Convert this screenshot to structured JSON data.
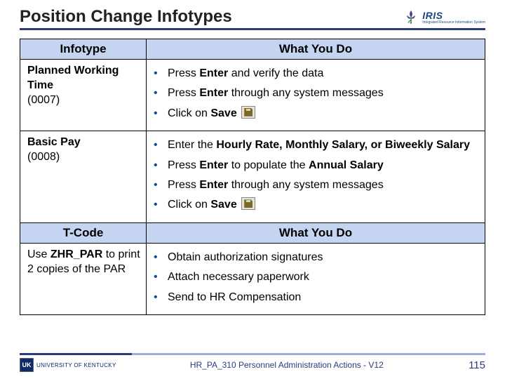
{
  "title": "Position Change Infotypes",
  "logo": {
    "text": "IRIS",
    "sub": "Integrated Resource Information System"
  },
  "table": {
    "headers1": {
      "left": "Infotype",
      "right": "What You Do"
    },
    "rows": [
      {
        "left_bold": "Planned Working Time",
        "left_plain": "(0007)",
        "items": [
          {
            "pre": "Press ",
            "b1": "Enter",
            "mid": " and verify the data"
          },
          {
            "pre": "Press ",
            "b1": "Enter",
            "mid": " through any system messages"
          },
          {
            "pre": "Click on ",
            "b1": "Save",
            "icon": true
          }
        ]
      },
      {
        "left_bold": "Basic Pay",
        "left_plain": "(0008)",
        "items": [
          {
            "pre": "Enter the ",
            "b1": "Hourly Rate, Monthly Salary, or Biweekly Salary"
          },
          {
            "pre": "Press ",
            "b1": "Enter",
            "mid": " to populate the ",
            "b2": "Annual Salary"
          },
          {
            "pre": "Press ",
            "b1": "Enter",
            "mid": " through any system messages"
          },
          {
            "pre": "Click on ",
            "b1": "Save",
            "icon": true
          }
        ]
      }
    ],
    "headers2": {
      "left": "T-Code",
      "right": "What You Do"
    },
    "rows2": [
      {
        "left_pre": "Use ",
        "left_bold": "ZHR_PAR",
        "left_post": " to print 2 copies of the PAR",
        "items": [
          {
            "pre": "Obtain authorization signatures"
          },
          {
            "pre": "Attach necessary paperwork"
          },
          {
            "pre": "Send to HR Compensation"
          }
        ]
      }
    ]
  },
  "footer": {
    "uk": "UNIVERSITY OF KENTUCKY",
    "center": "HR_PA_310 Personnel Administration Actions - V12",
    "page": "115"
  }
}
